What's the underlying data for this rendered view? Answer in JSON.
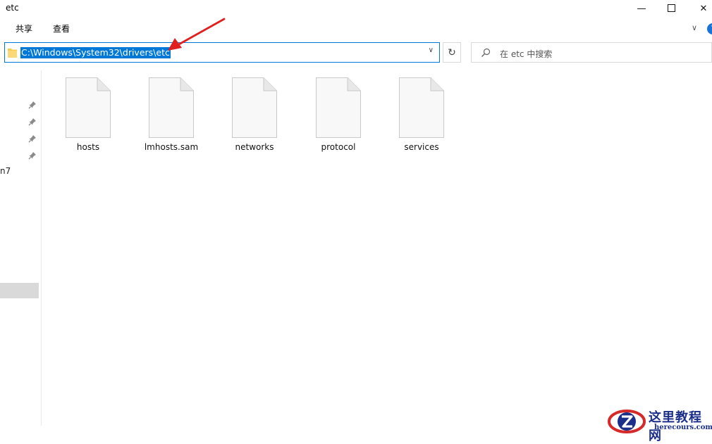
{
  "window": {
    "title": "etc",
    "minimize_glyph": "—",
    "maximize_glyph": "☐",
    "close_glyph": "✕"
  },
  "ribbon": {
    "tabs": [
      "共享",
      "查看"
    ],
    "collapse_glyph": "∨",
    "help_glyph": "?"
  },
  "address_bar": {
    "path": "C:\\Windows\\System32\\drivers\\etc",
    "dropdown_glyph": "∨",
    "refresh_glyph": "↻"
  },
  "search": {
    "placeholder": "在 etc 中搜索"
  },
  "nav_pane": {
    "pinned_items": 4,
    "truncated_label": "n7"
  },
  "files": [
    {
      "name": "hosts"
    },
    {
      "name": "lmhosts.sam"
    },
    {
      "name": "networks"
    },
    {
      "name": "protocol"
    },
    {
      "name": "services"
    }
  ],
  "watermark": {
    "title": "这里教程网",
    "url": "herecours.com"
  },
  "colors": {
    "accent": "#0078d7",
    "annotation_arrow": "#e02020",
    "watermark_blue": "#1a2e8a",
    "watermark_red": "#d42a2a"
  }
}
